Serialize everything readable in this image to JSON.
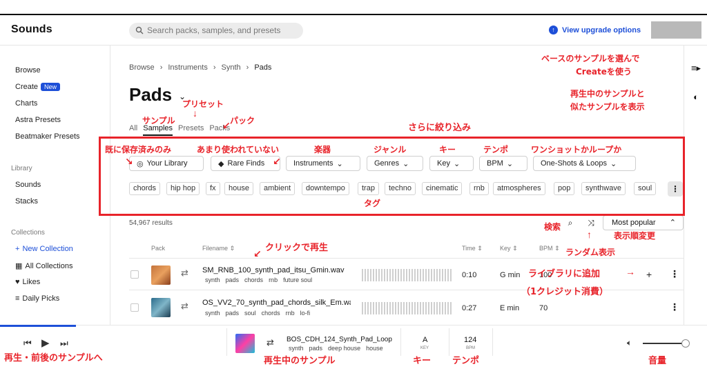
{
  "app": {
    "brand": "Sounds"
  },
  "search": {
    "placeholder": "Search packs, samples, and presets"
  },
  "header": {
    "upgrade_label": "View upgrade options"
  },
  "sidebar": {
    "browse": "Browse",
    "create": "Create",
    "new_badge": "New",
    "charts": "Charts",
    "astra": "Astra Presets",
    "beatmaker": "Beatmaker Presets",
    "library_title": "Library",
    "sounds": "Sounds",
    "stacks": "Stacks",
    "collections_title": "Collections",
    "new_collection": "New Collection",
    "all_collections": "All Collections",
    "likes": "Likes",
    "daily_picks": "Daily Picks"
  },
  "breadcrumb": [
    "Browse",
    "Instruments",
    "Synth",
    "Pads"
  ],
  "page": {
    "title": "Pads"
  },
  "tabs": {
    "all": "All",
    "samples": "Samples",
    "presets": "Presets",
    "packs": "Packs"
  },
  "filters": {
    "your_library": "Your Library",
    "rare_finds": "Rare Finds",
    "instruments": "Instruments",
    "genres": "Genres",
    "key": "Key",
    "bpm": "BPM",
    "oneshots": "One-Shots & Loops"
  },
  "tags": [
    "chords",
    "hip hop",
    "fx",
    "house",
    "ambient",
    "downtempo",
    "trap",
    "techno",
    "cinematic",
    "rnb",
    "atmospheres",
    "pop",
    "synthwave",
    "soul"
  ],
  "results": {
    "count": "54,967 results",
    "sort": "Most popular"
  },
  "table": {
    "headers": {
      "pack": "Pack",
      "filename": "Filename ⇕",
      "time": "Time ⇕",
      "key": "Key ⇕",
      "bpm": "BPM ⇕"
    },
    "rows": [
      {
        "filename": "SM_RNB_100_synth_pad_itsu_Gmin.wav",
        "tags": [
          "synth",
          "pads",
          "chords",
          "rnb",
          "future soul"
        ],
        "time": "0:10",
        "key": "G min",
        "bpm": "100"
      },
      {
        "filename": "OS_VV2_70_synth_pad_chords_silk_Em.wav",
        "tags": [
          "synth",
          "pads",
          "soul",
          "chords",
          "rnb",
          "lo-fi"
        ],
        "time": "0:27",
        "key": "E min",
        "bpm": "70"
      }
    ]
  },
  "player": {
    "name": "BOS_CDH_124_Synth_Pad_Loop",
    "tags": [
      "synth",
      "pads",
      "deep house",
      "house"
    ],
    "key": "A",
    "key_label": "KEY",
    "bpm": "124",
    "bpm_label": "BPM",
    "progress": 0.11,
    "volume": 0.9
  },
  "annotations": {
    "base_sample": "ベースのサンプルを選んで",
    "base_sample2": "Createを使う",
    "similar": "再生中のサンプルと",
    "similar2": "似たサンプルを表示",
    "preset": "プリセット",
    "sample": "サンプル",
    "pack": "パック",
    "narrow": "さらに絞り込み",
    "saved": "既に保存済みのみ",
    "rare": "あまり使われていない",
    "instrument": "楽器",
    "genre": "ジャンル",
    "key": "キー",
    "tempo": "テンポ",
    "oneshot": "ワンショットかループか",
    "tag": "タグ",
    "search": "検索",
    "random": "ランダム表示",
    "sort": "表示順変更",
    "click_play": "クリックで再生",
    "add_lib": "ライブラリに追加",
    "credit": "（1クレジット消費）",
    "prev_next": "再生・前後のサンプルへ",
    "now_playing": "再生中のサンプル",
    "key2": "キー",
    "tempo2": "テンポ",
    "volume": "音量"
  }
}
